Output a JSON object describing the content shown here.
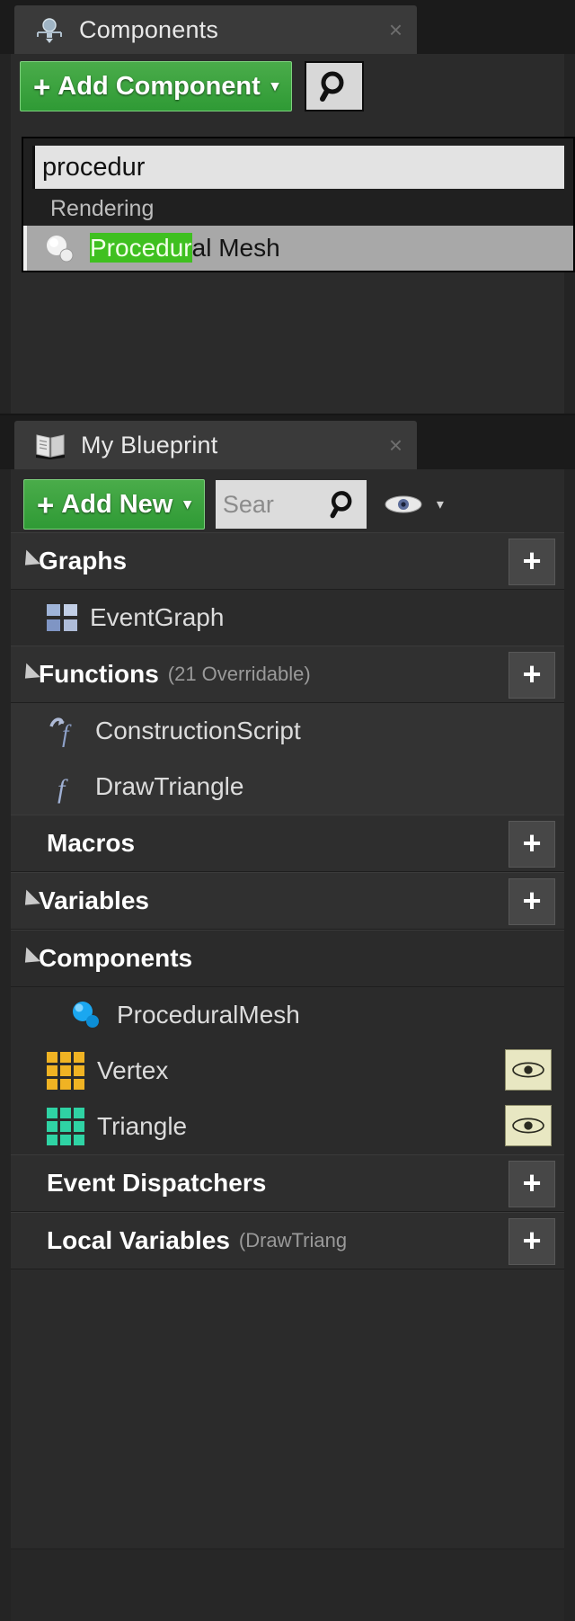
{
  "components_panel": {
    "tab": {
      "label": "Components",
      "icon": "components-icon",
      "close": "×"
    },
    "add_component_button": {
      "plus": "+",
      "label": "Add Component",
      "caret": "▾"
    },
    "search_button_icon": "search-icon",
    "dropdown": {
      "search_value": "procedur",
      "section_label": "Rendering",
      "item": {
        "icon": "procedural-mesh-icon",
        "highlight": "Procedur",
        "rest": "al Mesh"
      }
    }
  },
  "blueprint_panel": {
    "tab": {
      "label": "My Blueprint",
      "icon": "blueprint-book-icon",
      "close": "×"
    },
    "toolbar": {
      "add_new": {
        "plus": "+",
        "label": "Add New",
        "caret": "▾"
      },
      "search_placeholder": "Sear",
      "search_icon": "search-icon",
      "eye_icon": "eye-icon",
      "eye_caret": "▾"
    },
    "sections": [
      {
        "name": "Graphs",
        "sub": "",
        "collapsible": true,
        "add": "+",
        "items": [
          {
            "label": "EventGraph",
            "icon": "event-graph-icon"
          }
        ]
      },
      {
        "name": "Functions",
        "sub": "(21 Overridable)",
        "collapsible": true,
        "add": "+",
        "items": [
          {
            "label": "ConstructionScript",
            "icon": "construction-script-icon"
          },
          {
            "label": "DrawTriangle",
            "icon": "function-icon"
          }
        ]
      },
      {
        "name": "Macros",
        "sub": "",
        "collapsible": false,
        "add": "+",
        "items": []
      },
      {
        "name": "Variables",
        "sub": "",
        "collapsible": true,
        "add": "+",
        "items": []
      },
      {
        "name": "Components",
        "sub": "",
        "collapsible": true,
        "add": "",
        "items": [
          {
            "label": "ProceduralMesh",
            "icon": "procedural-mesh-icon",
            "eye": false
          },
          {
            "label": "Vertex",
            "icon": "array-variable-icon",
            "color": "#f0b323",
            "eye": true,
            "eye_icon": "eye-icon"
          },
          {
            "label": "Triangle",
            "icon": "array-variable-icon",
            "color": "#2fd3a4",
            "eye": true,
            "eye_icon": "eye-icon"
          }
        ]
      },
      {
        "name": "Event Dispatchers",
        "sub": "",
        "collapsible": false,
        "add": "+",
        "items": []
      },
      {
        "name": "Local Variables",
        "sub": "(DrawTriang",
        "collapsible": false,
        "add": "+",
        "items": []
      }
    ]
  },
  "colors": {
    "accent_green": "#3fc020",
    "panel_bg": "#2b2b2b",
    "vertex": "#f0b323",
    "triangle": "#2fd3a4",
    "mesh_blue": "#1ba7f0"
  }
}
